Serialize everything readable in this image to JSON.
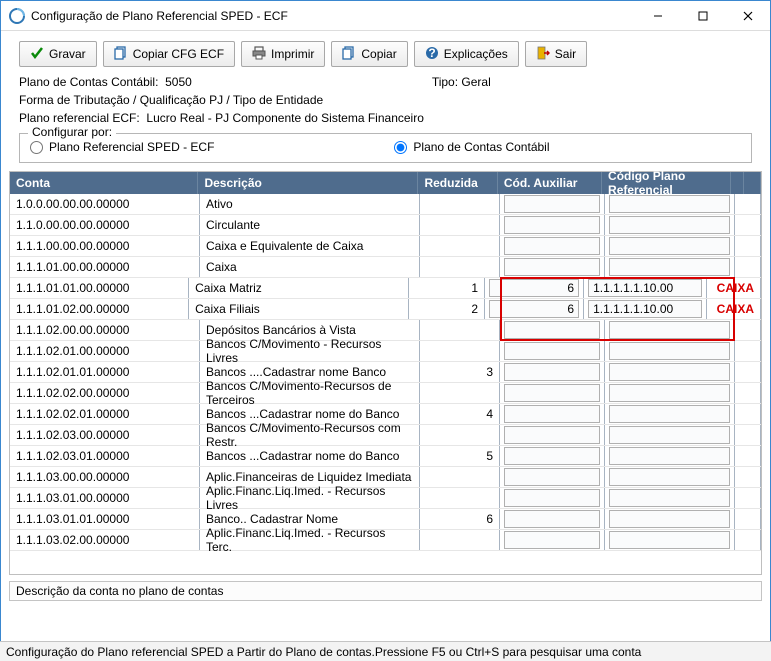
{
  "window": {
    "title": "Configuração de Plano Referencial SPED - ECF"
  },
  "toolbar": {
    "gravar": "Gravar",
    "copiar_cfg": "Copiar CFG ECF",
    "imprimir": "Imprimir",
    "copiar": "Copiar",
    "explicacoes": "Explicações",
    "sair": "Sair"
  },
  "info": {
    "plano_label": "Plano de Contas Contábil:",
    "plano_value": "5050",
    "tipo_label": "Tipo:",
    "tipo_value": "Geral",
    "forma": "Forma de Tributação / Qualificação PJ / Tipo de Entidade",
    "plano_ref_label": "Plano referencial ECF:",
    "plano_ref_value": "Lucro Real - PJ Componente do Sistema Financeiro"
  },
  "config_group": {
    "legend": "Configurar por:",
    "opt1": "Plano Referencial SPED - ECF",
    "opt2": "Plano de Contas Contábil"
  },
  "columns": {
    "conta": "Conta",
    "descricao": "Descrição",
    "reduzida": "Reduzida",
    "cod_aux": "Cód. Auxiliar",
    "cod_ref": "Código Plano Referencial"
  },
  "rows": [
    {
      "conta": "1.0.0.00.00.00.00000",
      "desc": "Ativo",
      "red": "",
      "aux": "",
      "ref": ""
    },
    {
      "conta": "1.1.0.00.00.00.00000",
      "desc": "Circulante",
      "red": "",
      "aux": "",
      "ref": ""
    },
    {
      "conta": "1.1.1.00.00.00.00000",
      "desc": "Caixa e Equivalente de Caixa",
      "red": "",
      "aux": "",
      "ref": ""
    },
    {
      "conta": "1.1.1.01.00.00.00000",
      "desc": "Caixa",
      "red": "",
      "aux": "",
      "ref": ""
    },
    {
      "conta": "1.1.1.01.01.00.00000",
      "desc": "Caixa Matriz",
      "red": "1",
      "aux": "6",
      "ref": "1.1.1.1.1.10.00",
      "hl": true,
      "label": "CAIXA"
    },
    {
      "conta": "1.1.1.01.02.00.00000",
      "desc": "Caixa Filiais",
      "red": "2",
      "aux": "6",
      "ref": "1.1.1.1.1.10.00",
      "hl": true,
      "label": "CAIXA"
    },
    {
      "conta": "1.1.1.02.00.00.00000",
      "desc": "Depósitos Bancários à Vista",
      "red": "",
      "aux": "",
      "ref": ""
    },
    {
      "conta": "1.1.1.02.01.00.00000",
      "desc": "Bancos C/Movimento - Recursos Livres",
      "red": "",
      "aux": "",
      "ref": ""
    },
    {
      "conta": "1.1.1.02.01.01.00000",
      "desc": "Bancos ....Cadastrar nome Banco",
      "red": "3",
      "aux": "",
      "ref": ""
    },
    {
      "conta": "1.1.1.02.02.00.00000",
      "desc": "Bancos C/Movimento-Recursos de Terceiros",
      "red": "",
      "aux": "",
      "ref": ""
    },
    {
      "conta": "1.1.1.02.02.01.00000",
      "desc": "Bancos ...Cadastrar nome do Banco",
      "red": "4",
      "aux": "",
      "ref": ""
    },
    {
      "conta": "1.1.1.02.03.00.00000",
      "desc": "Bancos C/Movimento-Recursos com Restr.",
      "red": "",
      "aux": "",
      "ref": ""
    },
    {
      "conta": "1.1.1.02.03.01.00000",
      "desc": "Bancos ...Cadastrar nome do Banco",
      "red": "5",
      "aux": "",
      "ref": ""
    },
    {
      "conta": "1.1.1.03.00.00.00000",
      "desc": "Aplic.Financeiras de Liquidez Imediata",
      "red": "",
      "aux": "",
      "ref": ""
    },
    {
      "conta": "1.1.1.03.01.00.00000",
      "desc": "Aplic.Financ.Liq.Imed. - Recursos Livres",
      "red": "",
      "aux": "",
      "ref": ""
    },
    {
      "conta": "1.1.1.03.01.01.00000",
      "desc": "Banco.. Cadastrar Nome",
      "red": "6",
      "aux": "",
      "ref": ""
    },
    {
      "conta": "1.1.1.03.02.00.00000",
      "desc": "Aplic.Financ.Liq.Imed. - Recursos Terc.",
      "red": "",
      "aux": "",
      "ref": ""
    }
  ],
  "desc_bar": "Descrição da conta no plano de contas",
  "statusbar": "Configuração do Plano referencial SPED a Partir do Plano de contas.Pressione F5 ou Ctrl+S para pesquisar uma conta"
}
